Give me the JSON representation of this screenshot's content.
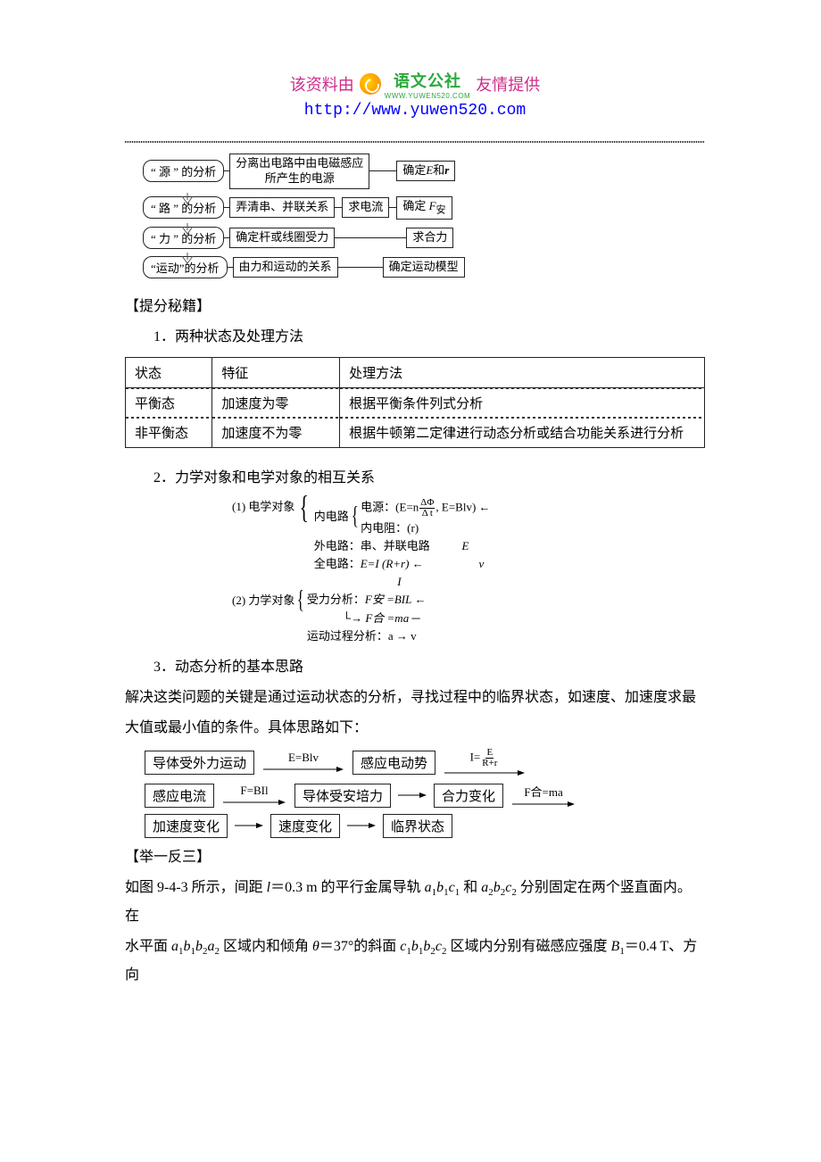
{
  "header": {
    "resource_left": "该资料由",
    "logo_text_main": "语文公社",
    "logo_text_sub": "WWW.YUWEN520.COM",
    "resource_right": "友情提供",
    "url": "http://www.yuwen520.com"
  },
  "flow1": {
    "r1_pill": "“ 源 ” 的分析",
    "r1_rect": "分离出电路中由电磁感应\n所产生的电源",
    "r1_end_text": "确定",
    "r1_end_ital1": "E",
    "r1_end_and": "和",
    "r1_end_ital2": "r",
    "r2_pill": "“ 路 ” 的分析",
    "r2_rect1": "弄清串、并联关系",
    "r2_rect2": "求电流",
    "r2_rect3_text": "确定 ",
    "r2_rect3_ital": "F",
    "r2_rect3_sub": "安",
    "r3_pill": "“ 力 ” 的分析",
    "r3_rect1": "确定杆或线圈受力",
    "r3_rect2": "求合力",
    "r4_pill": "“运动”的分析",
    "r4_rect1": "由力和运动的关系",
    "r4_rect2": "确定运动模型"
  },
  "secrets_title": "【提分秘籍】",
  "sec1_num": "1．两种状态及处理方法",
  "table1": {
    "h1": "状态",
    "h2": "特征",
    "h3": "处理方法",
    "r1c1": "平衡态",
    "r1c2": "加速度为零",
    "r1c3": "根据平衡条件列式分析",
    "r2c1": "非平衡态",
    "r2c2": "加速度不为零",
    "r2c3": "根据牛顿第二定律进行动态分析或结合功能关系进行分析"
  },
  "sec2_num": "2．力学对象和电学对象的相互关系",
  "bracket": {
    "L1": "(1) 电学对象",
    "A1": "内电路",
    "A1a_pre": "电源：(E=n",
    "A1a_frac_num": "ΔΦ",
    "A1a_frac_den": "Δ t",
    "A1a_post": ", E=Blv)",
    "A1b": "内电阻：(r)",
    "A2": "外电路：串、并联电路",
    "A3_pre": "全电路：",
    "A3_ital": "E=I (R+r)",
    "side_E": "E",
    "side_I": "I",
    "side_v": "v",
    "L2": "(2) 力学对象",
    "B1_pre": "受力分析：",
    "B1_eq": "F安 =BIL",
    "B1b": "F合 =ma",
    "B2": "运动过程分析：a → v"
  },
  "sec3_num": "3．动态分析的基本思路",
  "para3_1": "解决这类问题的关键是通过运动状态的分析，寻找过程中的临界状态，如速度、加速度求最",
  "para3_2": "大值或最小值的条件。具体思路如下：",
  "flow2": {
    "b1": "导体受外力运动",
    "a1": "E=Blv",
    "b2": "感应电动势",
    "a2_pre": "I=",
    "a2_num": "E",
    "a2_den": "R+r",
    "b3": "感应电流",
    "a3": "F=BIl",
    "b4": "导体受安培力",
    "b5": "合力变化",
    "a5_pre": "F合",
    "a5_eq": "=ma",
    "b6": "加速度变化",
    "b7": "速度变化",
    "b8": "临界状态"
  },
  "examples_title": "【举一反三】",
  "para_ex_1a": "如图 9-4-3 所示，间距 ",
  "para_ex_1b": "l",
  "para_ex_1c": "＝0.3 m 的平行金属导轨 ",
  "trios1": [
    "a",
    "1",
    "b",
    "1",
    "c",
    "1"
  ],
  "para_ex_1d": " 和 ",
  "trios2": [
    "a",
    "2",
    "b",
    "2",
    "c",
    "2"
  ],
  "para_ex_1e": " 分别固定在两个竖直面内。在",
  "para_ex_2a": "水平面 ",
  "quads1": [
    "a",
    "1",
    "b",
    "1",
    "b",
    "2",
    "a",
    "2"
  ],
  "para_ex_2b": " 区域内和倾角 ",
  "theta": "θ",
  "para_ex_2c": "＝37°的斜面 ",
  "quads2": [
    "c",
    "1",
    "b",
    "1",
    "b",
    "2",
    "c",
    "2"
  ],
  "para_ex_2d": " 区域内分别有磁感应强度 ",
  "B1": "B",
  "B1sub": "1",
  "para_ex_2e": "＝0.4 T、方向"
}
